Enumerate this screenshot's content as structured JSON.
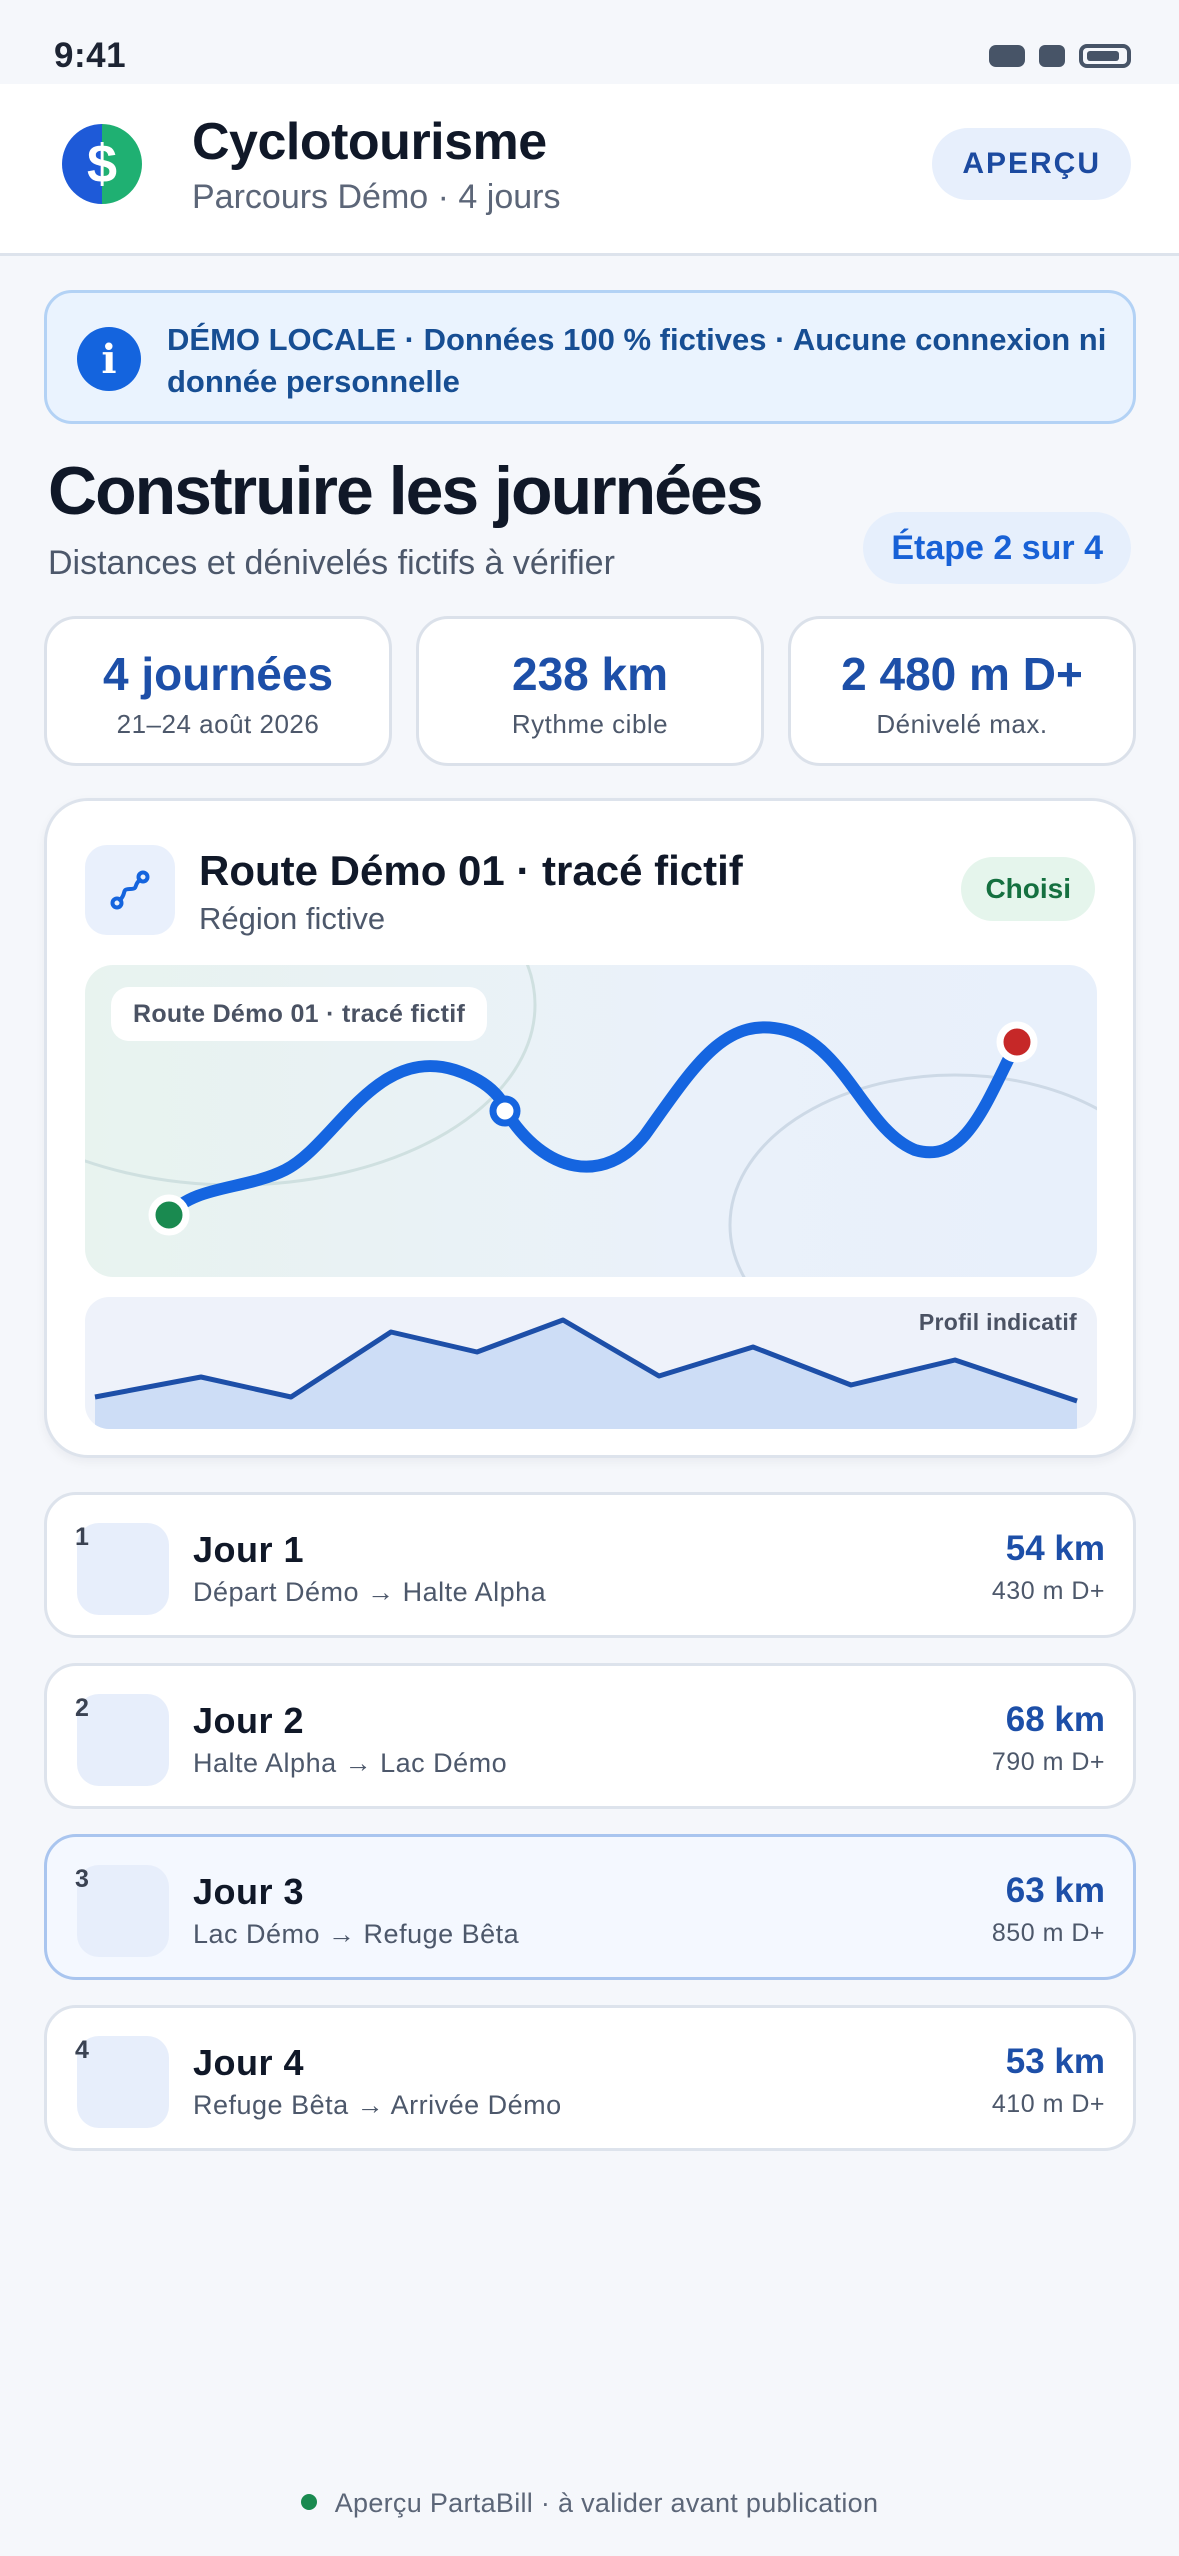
{
  "status_bar": {
    "time": "9:41"
  },
  "header": {
    "logo_glyph": "$",
    "title": "Cyclotourisme",
    "subtitle": "Parcours Démo · 4 jours",
    "preview_button": "APERÇU"
  },
  "banner": {
    "icon": "info-icon",
    "text": "DÉMO LOCALE · Données 100 % fictives · Aucune connexion ni donnée personnelle"
  },
  "section": {
    "title": "Construire les journées",
    "subtitle": "Distances et dénivelés fictifs à vérifier",
    "step": "Étape 2 sur 4"
  },
  "stats": [
    {
      "value": "4 journées",
      "label": "21–24 août 2026"
    },
    {
      "value": "238 km",
      "label": "Rythme cible"
    },
    {
      "value": "2 480 m D+",
      "label": "Dénivelé max."
    }
  ],
  "route": {
    "title": "Route Démo 01 · tracé fictif",
    "region": "Région fictive",
    "status": "Choisi",
    "map_label": "Route Démo 01 · tracé fictif",
    "profile_label": "Profil indicatif"
  },
  "days": [
    {
      "num": "1",
      "title": "Jour 1",
      "route": "Départ Démo → Halte Alpha",
      "km": "54 km",
      "dplus": "430 m D+"
    },
    {
      "num": "2",
      "title": "Jour 2",
      "route": "Halte Alpha → Lac Démo",
      "km": "68 km",
      "dplus": "790 m D+"
    },
    {
      "num": "3",
      "title": "Jour 3",
      "route": "Lac Démo → Refuge Bêta",
      "km": "63 km",
      "dplus": "850 m D+"
    },
    {
      "num": "4",
      "title": "Jour 4",
      "route": "Refuge Bêta → Arrivée Démo",
      "km": "53 km",
      "dplus": "410 m D+"
    }
  ],
  "footer": {
    "text": "Aperçu PartaBill · à valider avant publication"
  },
  "colors": {
    "primary": "#1464de",
    "accent_green": "#1a8a50",
    "end_marker": "#c62828",
    "selected_day_border": "#a9c5ef"
  }
}
